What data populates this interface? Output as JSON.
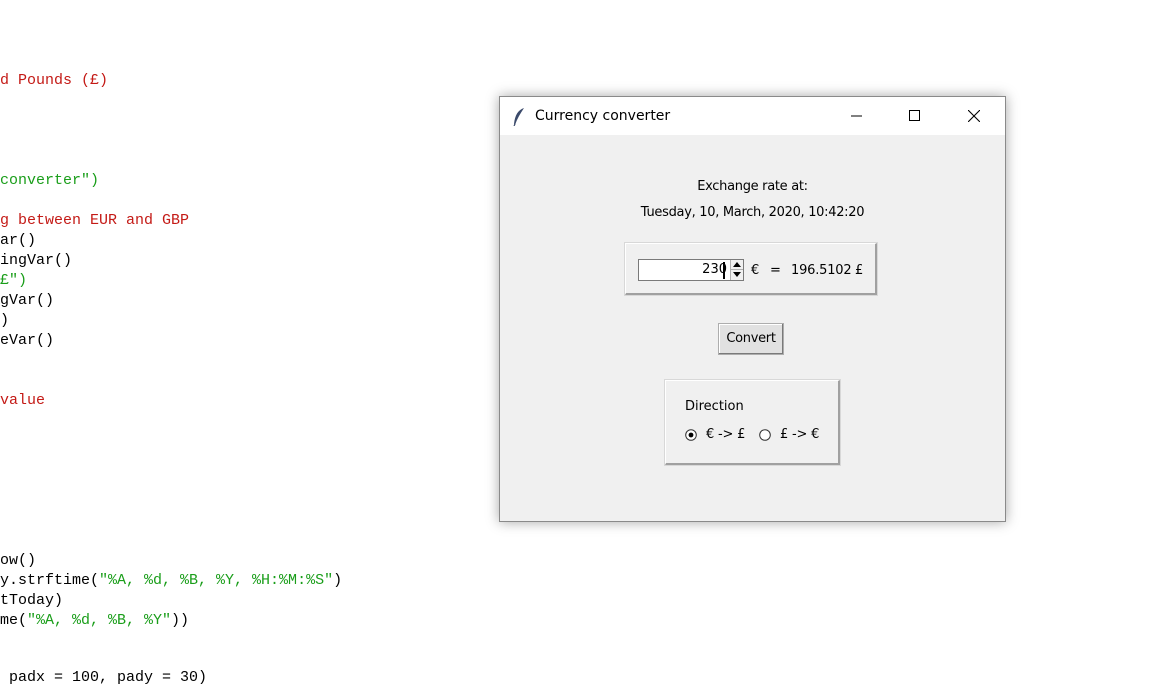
{
  "code_editor": {
    "lines": [
      {
        "text": "d Pounds (£)",
        "color": "#c41a16"
      },
      {
        "text": "converter\")",
        "color": "#1a9e1a"
      },
      {
        "text": "g between EUR and GBP",
        "color": "#c41a16"
      },
      {
        "text": "ar()",
        "color": "#000000"
      },
      {
        "text": "ingVar()",
        "color": "#000000"
      },
      {
        "text": "£\")",
        "color": "#1a9e1a"
      },
      {
        "text": "gVar()",
        "color": "#000000"
      },
      {
        "text": ")",
        "color": "#000000"
      },
      {
        "text": "eVar()",
        "color": "#000000"
      },
      {
        "text": "value",
        "color": "#c41a16"
      },
      {
        "text": "ow()",
        "color": "#000000"
      },
      {
        "text": "y.strftime(\"%A, %d, %B, %Y, %H:%M:%S\")",
        "color": "#000000"
      },
      {
        "text": "tToday)",
        "color": "#000000"
      },
      {
        "text": "me(\"%A, %d, %B, %Y\"))",
        "color": "#000000"
      },
      {
        "text": " padx = 100, pady = 30)",
        "color": "#000000"
      }
    ],
    "line_11_parts": [
      ".strftime(",
      "\"%A, %d, %B, %Y, %H:%M:%S\"",
      ")"
    ],
    "line_13_parts": [
      "me(",
      "\"%A, %d, %B, %Y\"",
      "))"
    ]
  },
  "window": {
    "title": "Currency converter",
    "icon": "feather-icon",
    "controls": {
      "minimize": "minimize-icon",
      "maximize": "maximize-icon",
      "close": "close-icon"
    }
  },
  "content": {
    "rate_label": "Exchange rate at:",
    "date_label": "Tuesday, 10, March, 2020, 10:42:20",
    "amount_value": "230",
    "euro_symbol": "€",
    "equals": "=",
    "result_value": "196.5102",
    "pound_symbol": "£",
    "convert_label": "Convert",
    "direction_title": "Direction",
    "direction_options": [
      {
        "label": "€ -> £",
        "selected": true
      },
      {
        "label": "£ -> €",
        "selected": false
      }
    ]
  },
  "colors": {
    "window_bg": "#f0f0f0",
    "titlebar_bg": "#ffffff",
    "code_red": "#c41a16",
    "code_green": "#1a9e1a"
  }
}
